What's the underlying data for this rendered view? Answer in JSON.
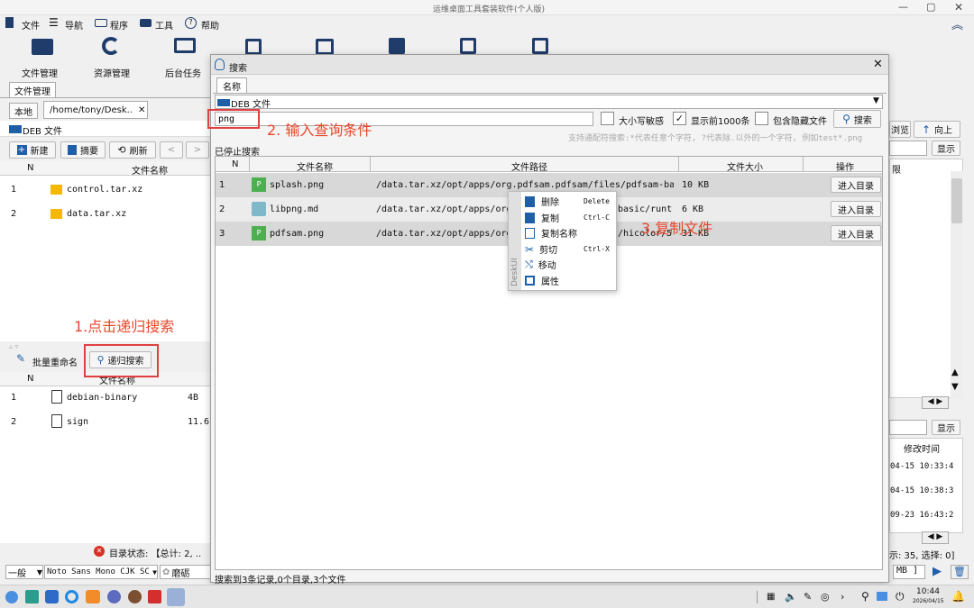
{
  "window": {
    "title": "运维桌面工具套装软件(个人版)"
  },
  "menubar": {
    "file": "文件",
    "nav": "导航",
    "program": "程序",
    "tools": "工具",
    "help": "帮助"
  },
  "toolbar": {
    "file_manager": "文件管理",
    "resource_manager": "资源管理",
    "background_tasks": "后台任务"
  },
  "left": {
    "tab_file_manager": "文件管理",
    "tab_local": "本地",
    "path": "/home/tony/Desk..",
    "folder_label": "DEB 文件",
    "new": "新建",
    "summary": "摘要",
    "refresh": "刷新",
    "col_n": "N",
    "col_name": "文件名称",
    "rows": [
      {
        "n": "1",
        "name": "control.tar.xz"
      },
      {
        "n": "2",
        "name": "data.tar.xz"
      }
    ],
    "batch_rename": "批量重命名",
    "recursive_search": "递归搜索",
    "rows2": [
      {
        "n": "1",
        "name": "debian-binary",
        "size": "4B"
      },
      {
        "n": "2",
        "name": "sign",
        "size": "11.6"
      }
    ],
    "status": "目录状态: 【总计: 2, .."
  },
  "bottom": {
    "mode": "一般",
    "font": "Noto Sans Mono CJK SC",
    "skin": "磨砺"
  },
  "right": {
    "browse": "浏览",
    "up": "向上",
    "show": "显示",
    "col_limit": "限",
    "show2": "显示",
    "col_mtime": "修改时间",
    "mtimes": [
      "04-15 10:33:4",
      "04-15 10:38:3",
      "09-23 16:43:2"
    ],
    "status": "示: 35, 选择: 0]",
    "mb": "MB ]"
  },
  "dialog": {
    "title": "搜索",
    "tab_name": "名称",
    "source": "DEB 文件",
    "query": "png",
    "case_sensitive": "大小写敏感",
    "show_first": "显示前1000条",
    "include_hidden": "包含隐藏文件",
    "search": "搜索",
    "hint": "支持通配符搜索:*代表任意个字符, ?代表除.以外的一个字符, 例如test*.png",
    "stopped": "已停止搜索",
    "cols": {
      "n": "N",
      "name": "文件名称",
      "path": "文件路径",
      "size": "文件大小",
      "action": "操作"
    },
    "rows": [
      {
        "n": "1",
        "name": "splash.png",
        "path": "/data.tar.xz/opt/apps/org.pdfsam.pdfsam/files/pdfsam-basic",
        "size": "10 KB",
        "action": "进入目录"
      },
      {
        "n": "2",
        "name": "libpng.md",
        "path": "/data.tar.xz/opt/apps/org.pdf",
        "path_tail": "basic/runt",
        "size": "6 KB",
        "action": "进入目录"
      },
      {
        "n": "3",
        "name": "pdfsam.png",
        "path": "/data.tar.xz/opt/apps/org.pdf",
        "path_tail": "/hicolor/5",
        "size": "31 KB",
        "action": "进入目录"
      }
    ],
    "footer": "搜索到3条记录,0个目录,3个文件"
  },
  "context_menu": {
    "sidebar": "DeskUI",
    "items": [
      {
        "label": "删除",
        "shortcut": "Delete"
      },
      {
        "label": "复制",
        "shortcut": "Ctrl-C"
      },
      {
        "label": "复制名称",
        "shortcut": ""
      },
      {
        "label": "剪切",
        "shortcut": "Ctrl-X"
      },
      {
        "label": "移动",
        "shortcut": ""
      },
      {
        "label": "属性",
        "shortcut": ""
      }
    ]
  },
  "annotations": {
    "step1": "1.点击递归搜索",
    "step2": "2. 输入查询条件",
    "step3": "3.复制文件"
  },
  "taskbar": {
    "time": "10:44",
    "date": "2026/04/15"
  },
  "colors": {
    "annotation": "#e8472c",
    "dialog_title_bg": "#e4e4e4",
    "accent": "#1f5fa8"
  }
}
